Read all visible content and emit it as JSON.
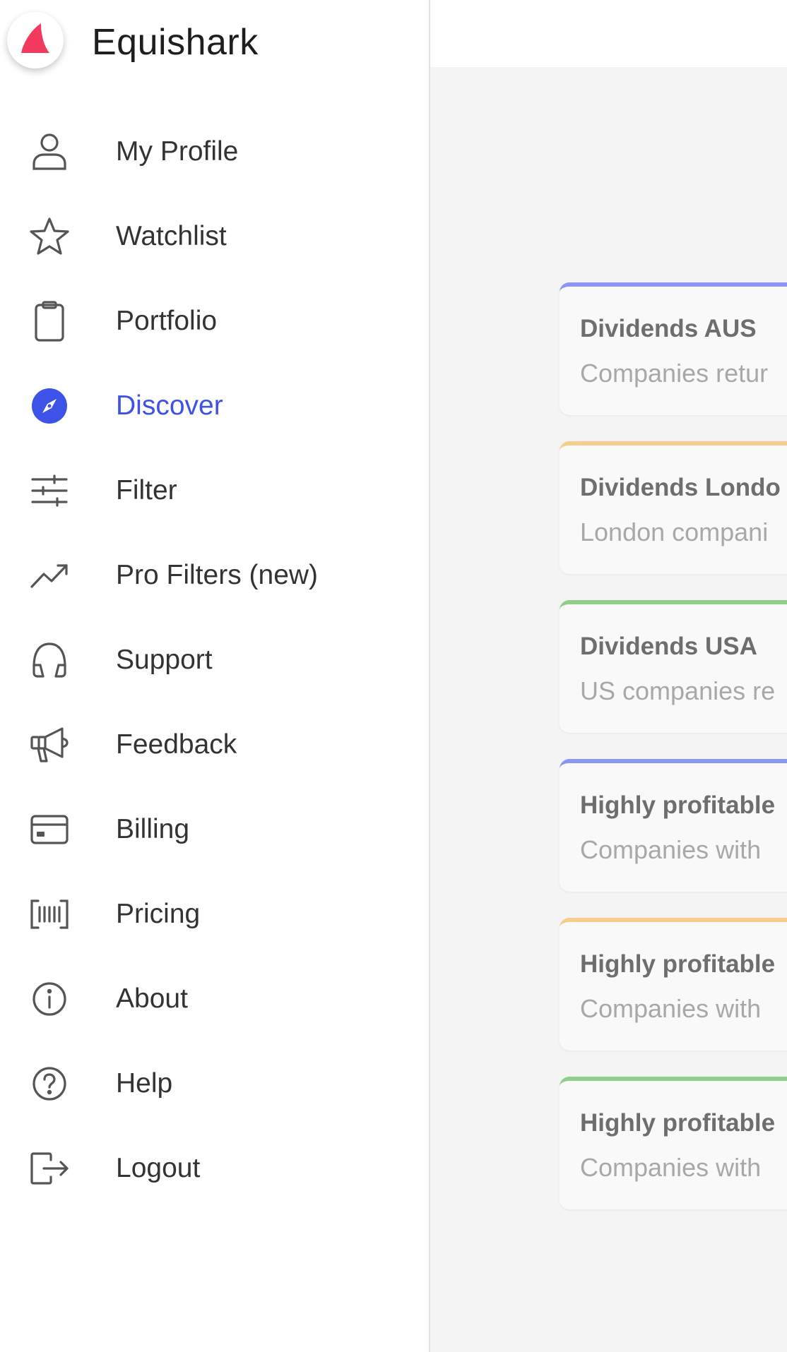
{
  "app": {
    "title": "Equishark",
    "accent": "#3d52e6",
    "logo_color": "#f2395f"
  },
  "nav": {
    "items": [
      {
        "label": "My Profile",
        "icon": "user-icon"
      },
      {
        "label": "Watchlist",
        "icon": "star-icon"
      },
      {
        "label": "Portfolio",
        "icon": "clipboard-icon"
      },
      {
        "label": "Discover",
        "icon": "compass-icon",
        "active": true
      },
      {
        "label": "Filter",
        "icon": "sliders-icon"
      },
      {
        "label": "Pro Filters (new)",
        "icon": "trending-up-icon"
      },
      {
        "label": "Support",
        "icon": "headphones-icon"
      },
      {
        "label": "Feedback",
        "icon": "megaphone-icon"
      },
      {
        "label": "Billing",
        "icon": "credit-card-icon"
      },
      {
        "label": "Pricing",
        "icon": "barcode-icon"
      },
      {
        "label": "About",
        "icon": "info-icon"
      },
      {
        "label": "Help",
        "icon": "help-icon"
      },
      {
        "label": "Logout",
        "icon": "logout-icon"
      }
    ]
  },
  "cards": [
    {
      "title": "Dividends AUS",
      "desc": "Companies retur",
      "accent": "#8a96f0"
    },
    {
      "title": "Dividends Londo",
      "desc": "London compani",
      "accent": "#f7cd8e"
    },
    {
      "title": "Dividends USA",
      "desc": "US companies re",
      "accent": "#8fcf8a"
    },
    {
      "title": "Highly profitable",
      "desc": "Companies with",
      "accent": "#8a96f0"
    },
    {
      "title": "Highly profitable",
      "desc": "Companies with",
      "accent": "#f7cd8e"
    },
    {
      "title": "Highly profitable",
      "desc": "Companies with",
      "accent": "#8fcf8a"
    }
  ]
}
